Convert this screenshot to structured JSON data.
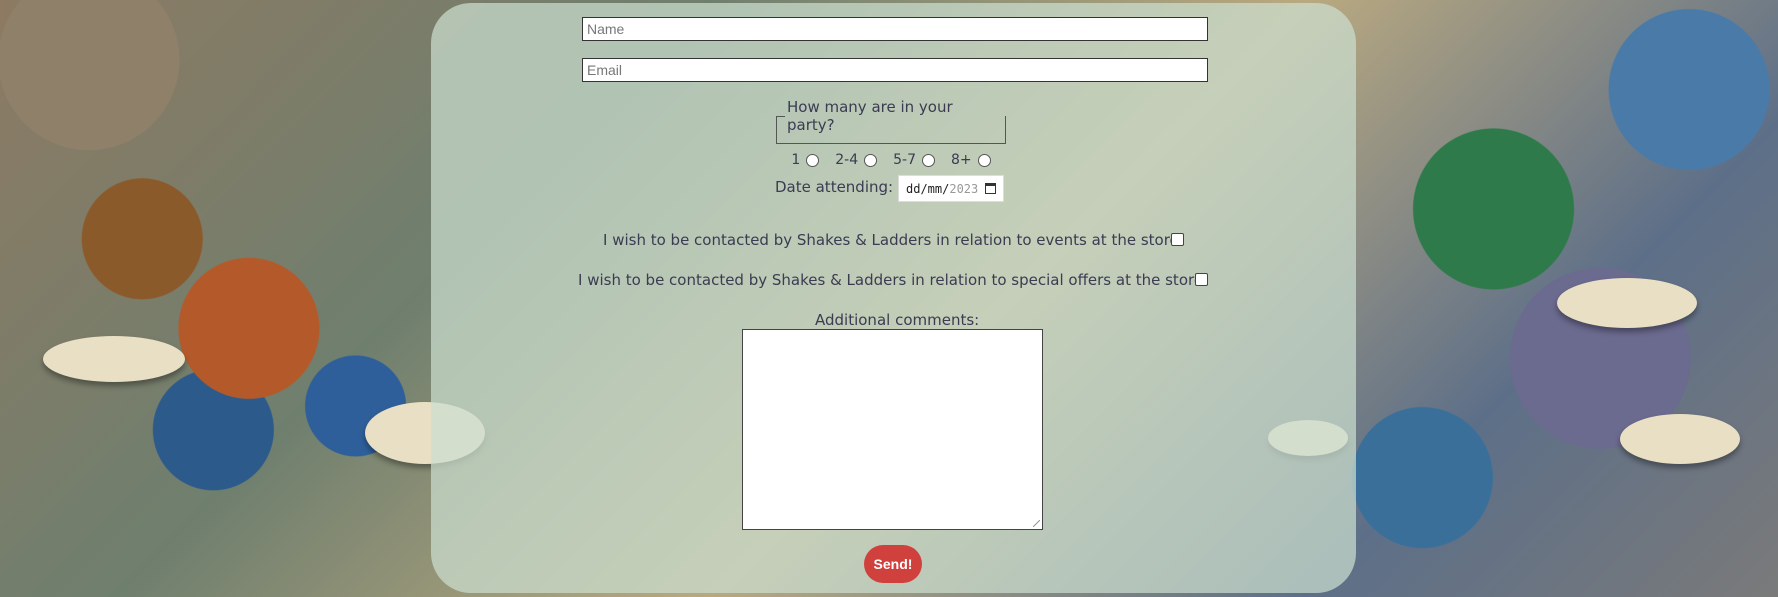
{
  "form": {
    "name_placeholder": "Name",
    "email_placeholder": "Email",
    "party": {
      "legend": "How many are in your party?",
      "options": [
        "1",
        "2-4",
        "5-7",
        "8+"
      ]
    },
    "date": {
      "label": "Date attending:",
      "value_mask": "dd/mm/",
      "year": "2023"
    },
    "contact_events_label": "I wish to be contacted by Shakes & Ladders in relation to events at the store:",
    "contact_offers_label": "I wish to be contacted by Shakes & Ladders in relation to special offers at the store:",
    "comments_label": "Additional comments:",
    "submit_label": "Send!"
  },
  "colors": {
    "panel_bg": "#cbdecf",
    "text": "#3b3b52",
    "button": "#d0413e"
  },
  "icons": [
    "calendar-icon",
    "resize-grip-icon"
  ]
}
